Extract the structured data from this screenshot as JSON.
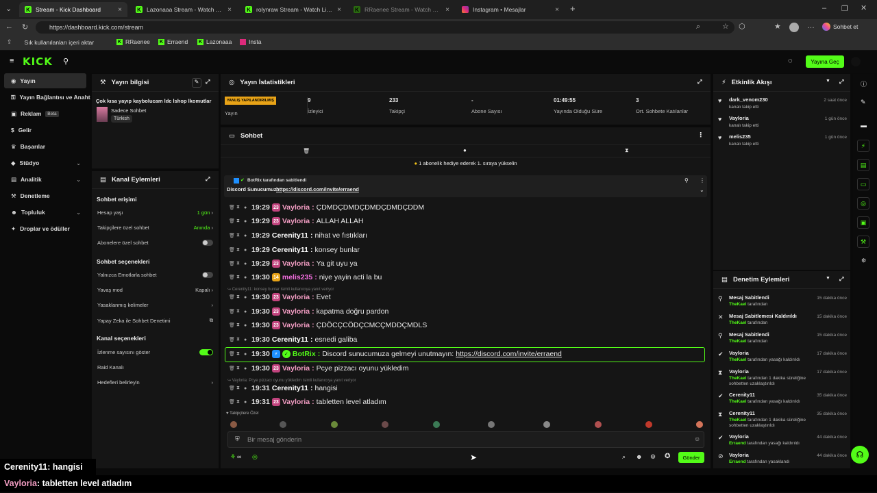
{
  "browser": {
    "tabs": [
      {
        "title": "Stream - Kick Dashboard",
        "icon": "kick-icon",
        "active": true
      },
      {
        "title": "Lazonaaa Stream - Watch Live on K",
        "icon": "kick-icon"
      },
      {
        "title": "rolynraw Stream - Watch Live on K",
        "icon": "kick-icon"
      },
      {
        "title": "RRaenee Stream - Watch Live on K",
        "icon": "kick-icon"
      },
      {
        "title": "Instagram • Mesajlar",
        "icon": "instagram-icon"
      }
    ],
    "url": "https://dashboard.kick.com/stream",
    "profile_button": "Sohbet et",
    "bookmarks": [
      "Sık kullanılanları içeri aktar",
      "RRaenee",
      "Erraend",
      "Lazonaaa",
      "Insta"
    ]
  },
  "header": {
    "logo": "KICK",
    "go_live": "Yayına Geç"
  },
  "sidebar": {
    "items": [
      {
        "label": "Yayın",
        "active": true,
        "icon": "broadcast-icon"
      },
      {
        "label": "Yayın Bağlantısı ve Anahtar",
        "icon": "key-icon"
      },
      {
        "label": "Reklam",
        "badge": "Beta",
        "icon": "ad-icon"
      },
      {
        "label": "Gelir",
        "icon": "money-icon"
      },
      {
        "label": "Başarılar",
        "icon": "trophy-icon"
      },
      {
        "label": "Stüdyo",
        "chevron": true,
        "icon": "studio-icon"
      },
      {
        "label": "Analitik",
        "chevron": true,
        "icon": "chart-icon"
      },
      {
        "label": "Denetleme",
        "icon": "hammer-icon"
      },
      {
        "label": "Topluluk",
        "chevron": true,
        "icon": "users-icon"
      },
      {
        "label": "Droplar ve ödüller",
        "icon": "gift-icon"
      }
    ]
  },
  "stream_info": {
    "title": "Yayın bilgisi",
    "stream_title": "Çok kısa yayıp kaybolucam ldc lshop lkomutlar",
    "category": "Sadece Sohbet",
    "tag": "Türkish"
  },
  "channel_actions": {
    "title": "Kanal Eylemleri",
    "chat_access": "Sohbet erişimi",
    "account_age": {
      "label": "Hesap yaşı",
      "value": "1 gün"
    },
    "followers_only": {
      "label": "Takipçilere özel sohbet",
      "value": "Anında"
    },
    "subs_only": "Abonelere özel sohbet",
    "chat_options": "Sohbet seçenekleri",
    "emotes_only": "Yalnızca Emotlarla sohbet",
    "slow_mode": {
      "label": "Yavaş mod",
      "value": "Kapalı"
    },
    "banned_words": "Yasaklanmış kelimeler",
    "ai_moderation": "Yapay Zeka ile Sohbet Denetimi",
    "channel_options": "Kanal seçenekleri",
    "show_viewers": "İzlenme sayısını göster",
    "raid": "Raid Kanalı",
    "goals": "Hedefleri belirleyin"
  },
  "stats": {
    "title": "Yayın İstatistikleri",
    "items": [
      {
        "value": "YANLIŞ YAPILANDIRILMIŞ",
        "label": "Yayın"
      },
      {
        "value": "9",
        "label": "İzleyici"
      },
      {
        "value": "233",
        "label": "Takipçi"
      },
      {
        "value": "-",
        "label": "Abone Sayısı"
      },
      {
        "value": "01:49:55",
        "label": "Yayında Olduğu Süre"
      },
      {
        "value": "3",
        "label": "Ort. Sohbete Katılanlar"
      }
    ]
  },
  "chat": {
    "title": "Sohbet",
    "gift_banner": "1 abonelik hediye ederek 1. sıraya yükselin",
    "pinned_by": "BotRix tarafından sabitlendi",
    "pinned_text": "Discord Sunucumuz:",
    "pinned_link": "https://discord.com/invite/erraend",
    "messages": [
      {
        "time": "19:29",
        "user": "Vayloria",
        "badge": "23",
        "text": "ÇDMDÇDMDÇDMDÇDMDÇDDM"
      },
      {
        "time": "19:29",
        "user": "Vayloria",
        "badge": "23",
        "text": "ALLAH ALLAH"
      },
      {
        "time": "19:29",
        "user": "Cerenity11",
        "text": "nihat ve fıstıkları"
      },
      {
        "time": "19:29",
        "user": "Cerenity11",
        "text": "konsey bunlar"
      },
      {
        "time": "19:29",
        "user": "Vayloria",
        "badge": "23",
        "text": "Ya git uyu ya"
      },
      {
        "time": "19:30",
        "user": "melis235",
        "badge": "14",
        "text": "niye yayin acti la bu"
      },
      {
        "reply": "Cerenity11: konsey bunlar isimli kullanıcıya yanıt veriyor"
      },
      {
        "time": "19:30",
        "user": "Vayloria",
        "badge": "23",
        "text": "Evet"
      },
      {
        "time": "19:30",
        "user": "Vayloria",
        "badge": "23",
        "text": "kapatma doğru pardon"
      },
      {
        "time": "19:30",
        "user": "Vayloria",
        "badge": "23",
        "text": "ÇDÖCÇCÖDÇCMCÇMDDÇMDLS"
      },
      {
        "time": "19:30",
        "user": "Cerenity11",
        "text": "esnedi galiba"
      },
      {
        "time": "19:30",
        "user": "BotRix",
        "bot": true,
        "text": "Discord sunucumuza gelmeyi unutmayın:",
        "link": "https://discord.com/invite/erraend"
      },
      {
        "time": "19:30",
        "user": "Vayloria",
        "badge": "23",
        "text": "Pcye pizzacı oyunu yükledim"
      },
      {
        "reply": "Vayloria: Pcye pizzacı oyunu yükledim isimli kullanıcıya yanıt veriyor"
      },
      {
        "time": "19:31",
        "user": "Cerenity11",
        "text": "hangisi"
      },
      {
        "time": "19:31",
        "user": "Vayloria",
        "badge": "23",
        "text": "tabletten level atladım"
      }
    ],
    "followers_label": "Takipçilere Özel",
    "input_placeholder": "Bir mesaj gönderin",
    "send": "Gönder",
    "points": "∞"
  },
  "activity": {
    "title": "Etkinlik Akışı",
    "items": [
      {
        "user": "dark_venom230",
        "text": "kanalı takip etti",
        "time": "2 saat önce"
      },
      {
        "user": "Vayloria",
        "text": "kanalı takip etti",
        "time": "1 gün önce"
      },
      {
        "user": "melis235",
        "text": "kanalı takip etti",
        "time": "1 gün önce"
      }
    ]
  },
  "moderation": {
    "title": "Denetim Eylemleri",
    "items": [
      {
        "action": "Mesaj Sabitlendi",
        "by": "TheKael",
        "detail": "tarafından",
        "time": "15 dakika önce",
        "icon": "pin-icon"
      },
      {
        "action": "Mesaj Sabitlemesi Kaldırıldı",
        "by": "TheKael",
        "detail": "tarafından",
        "time": "15 dakika önce",
        "icon": "unpin-icon"
      },
      {
        "action": "Mesaj Sabitlendi",
        "by": "TheKael",
        "detail": "tarafından",
        "time": "15 dakika önce",
        "icon": "pin-icon"
      },
      {
        "action": "Vayloria",
        "by": "TheKael",
        "detail": "tarafından yasağı kaldırıldı",
        "time": "17 dakika önce",
        "icon": "check-icon"
      },
      {
        "action": "Vayloria",
        "by": "TheKael",
        "detail": "tarafından 1 dakika süreliğine sohbetten uzaklaştırıldı",
        "time": "17 dakika önce",
        "icon": "hourglass-icon"
      },
      {
        "action": "Cerenity11",
        "by": "TheKael",
        "detail": "tarafından yasağı kaldırıldı",
        "time": "35 dakika önce",
        "icon": "check-icon"
      },
      {
        "action": "Cerenity11",
        "by": "TheKael",
        "detail": "tarafından 1 dakika süreliğine sohbetten uzaklaştırıldı",
        "time": "35 dakika önce",
        "icon": "hourglass-icon"
      },
      {
        "action": "Vayloria",
        "by": "Erraend",
        "detail": "tarafından yasağı kaldırıldı",
        "time": "44 dakika önce",
        "icon": "check-icon"
      },
      {
        "action": "Vayloria",
        "by": "Erraend",
        "detail": "tarafından yasaklandı",
        "time": "44 dakika önce",
        "icon": "ban-icon"
      }
    ]
  },
  "subtitles": [
    {
      "user": "Cerenity11",
      "text": " : hangisi"
    },
    {
      "user": "Vayloria",
      "text": " : tabletten level atladım"
    }
  ],
  "colors": {
    "accent": "#53fc18",
    "vayloria": "#f49ec4",
    "melis": "#f46ee0",
    "panel": "#151515"
  }
}
